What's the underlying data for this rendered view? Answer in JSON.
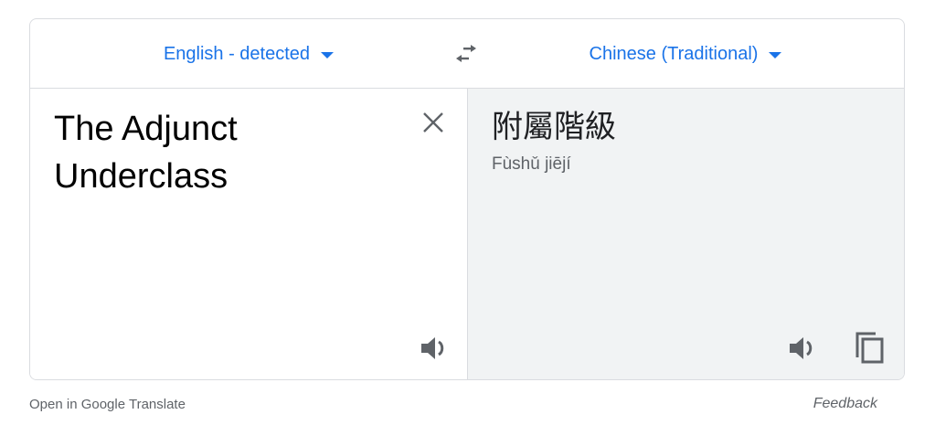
{
  "languages": {
    "source_label": "English - detected",
    "target_label": "Chinese (Traditional)"
  },
  "source": {
    "text": "The Adjunct\nUnderclass"
  },
  "target": {
    "text": "附屬階級",
    "romanization": "Fùshǔ jiējí"
  },
  "footer": {
    "open_link": "Open in Google Translate",
    "feedback": "Feedback"
  },
  "icons": {
    "swap": "swap-arrows-icon",
    "clear": "close-icon",
    "speak": "speaker-icon",
    "copy": "copy-icon",
    "dropdown": "caret-down-icon"
  },
  "colors": {
    "accent": "#1a73e8",
    "border": "#dadce0",
    "target_bg": "#f1f3f4",
    "icon": "#5f6368"
  }
}
